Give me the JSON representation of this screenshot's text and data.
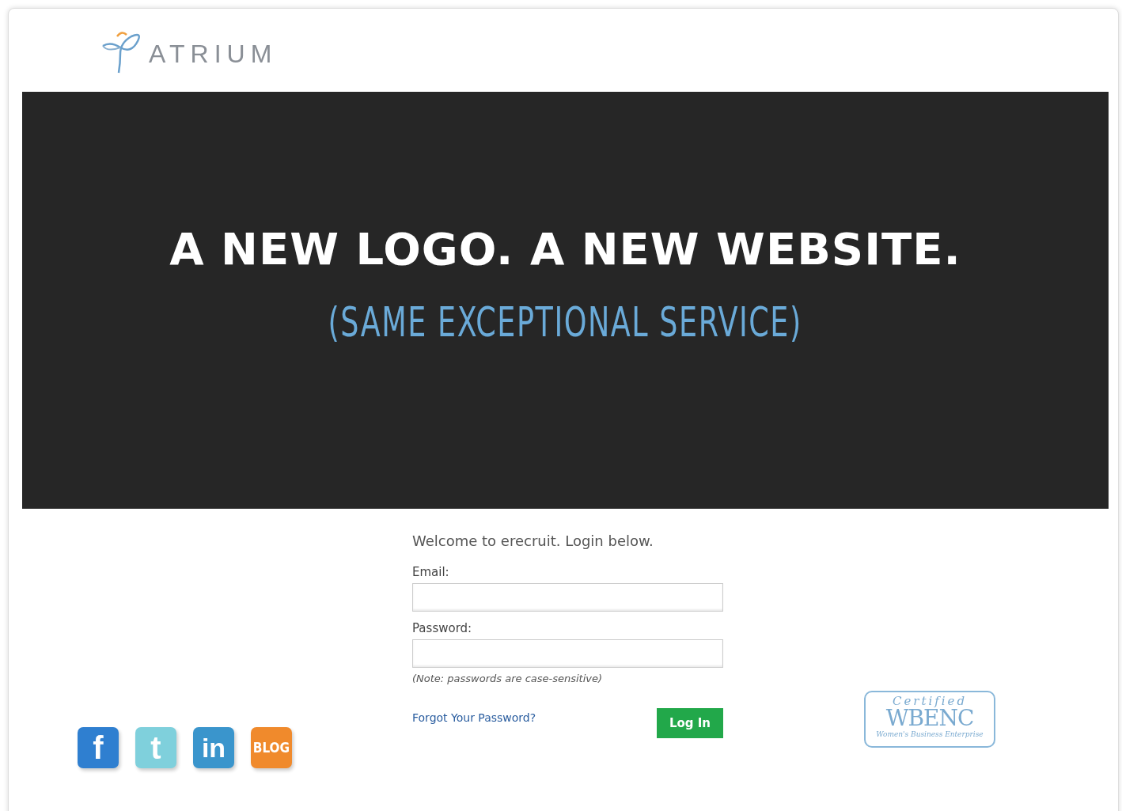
{
  "logo": {
    "wordmark": "ATRIUM"
  },
  "banner": {
    "headline": "A NEW LOGO. A NEW WEBSITE.",
    "subline": "(SAME EXCEPTIONAL SERVICE)"
  },
  "login": {
    "welcome": "Welcome to erecruit. Login below.",
    "fields": [
      {
        "label": "Email:"
      },
      {
        "label": "Password:"
      }
    ],
    "note": "(Note: passwords are case-sensitive)",
    "forgot_link": "Forgot Your Password?",
    "submit": "Log In"
  },
  "social": [
    {
      "kind": "facebook",
      "glyph": "f",
      "color": "#2f7fd0"
    },
    {
      "kind": "twitter",
      "glyph": "t",
      "color": "#7fd0dc"
    },
    {
      "kind": "linkedin",
      "glyph": "in",
      "color": "#3a95cc"
    },
    {
      "kind": "blog",
      "glyph": "BLOG",
      "color": "#f08a2c"
    }
  ],
  "badge": {
    "top": "Certified",
    "main": "WBENC",
    "bottom": "Women's Business Enterprise"
  }
}
